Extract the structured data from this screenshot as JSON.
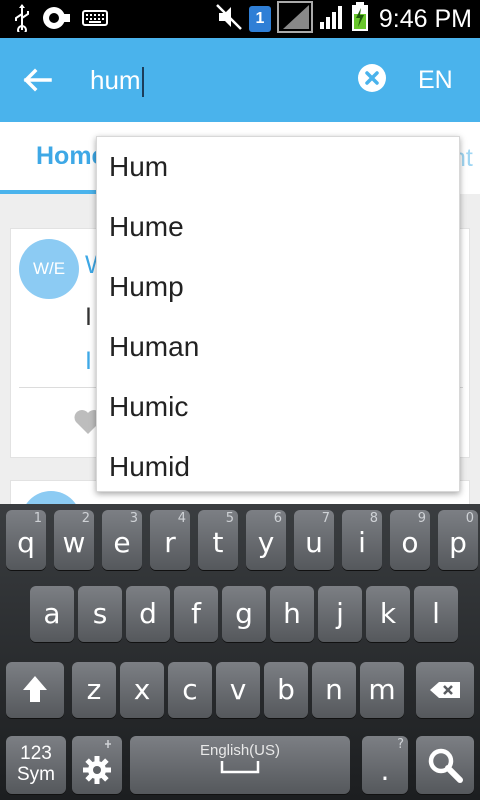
{
  "status_bar": {
    "time": "9:46 PM",
    "sim_slot": "1",
    "icons": [
      "usb-icon",
      "voicemail-icon",
      "keyboard-icon",
      "mute-icon",
      "sim-badge-icon",
      "signal-icon",
      "signal-icon",
      "battery-charging-icon"
    ]
  },
  "app_bar": {
    "search_value": "hum",
    "language": "EN",
    "accent": "#4ab3ec"
  },
  "tabs": {
    "home_label": "Home",
    "right_fragment": "nt"
  },
  "feed": {
    "card_avatar": "W/E",
    "card_title": "W",
    "card_text": "I",
    "card_link": "I"
  },
  "suggestions": [
    "Hum",
    "Hume",
    "Hump",
    "Human",
    "Humic",
    "Humid"
  ],
  "keyboard": {
    "row1": [
      {
        "key": "q",
        "num": "1"
      },
      {
        "key": "w",
        "num": "2"
      },
      {
        "key": "e",
        "num": "3"
      },
      {
        "key": "r",
        "num": "4"
      },
      {
        "key": "t",
        "num": "5"
      },
      {
        "key": "y",
        "num": "6"
      },
      {
        "key": "u",
        "num": "7"
      },
      {
        "key": "i",
        "num": "8"
      },
      {
        "key": "o",
        "num": "9"
      },
      {
        "key": "p",
        "num": "0"
      }
    ],
    "row2": [
      "a",
      "s",
      "d",
      "f",
      "g",
      "h",
      "j",
      "k",
      "l"
    ],
    "row3": [
      "z",
      "x",
      "c",
      "v",
      "b",
      "n",
      "m"
    ],
    "sym_label_1": "123",
    "sym_label_2": "Sym",
    "space_label": "English(US)",
    "period": ".",
    "period_extra": "?"
  }
}
